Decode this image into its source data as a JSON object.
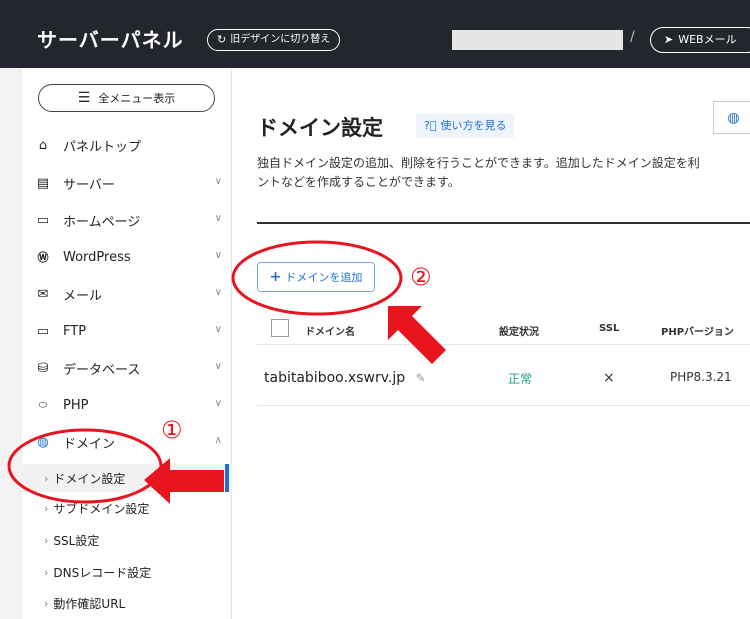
{
  "header": {
    "brand": "サーバーパネル",
    "old_design_label": "旧デザインに切り替え",
    "separator": "/",
    "webmail_label": "WEBメール"
  },
  "sidebar": {
    "menu_all_label": "全メニュー表示",
    "items": [
      {
        "label": "パネルトップ",
        "icon": "home-icon"
      },
      {
        "label": "サーバー",
        "icon": "server-icon"
      },
      {
        "label": "ホームページ",
        "icon": "window-icon"
      },
      {
        "label": "WordPress",
        "icon": "wordpress-icon"
      },
      {
        "label": "メール",
        "icon": "mail-icon"
      },
      {
        "label": "FTP",
        "icon": "monitor-icon"
      },
      {
        "label": "データベース",
        "icon": "database-icon"
      },
      {
        "label": "PHP",
        "icon": "php-icon"
      },
      {
        "label": "ドメイン",
        "icon": "globe-icon"
      }
    ],
    "sub_items": [
      {
        "label": "ドメイン設定"
      },
      {
        "label": "サブドメイン設定"
      },
      {
        "label": "SSL設定"
      },
      {
        "label": "DNSレコード設定"
      },
      {
        "label": "動作確認URL"
      }
    ]
  },
  "main": {
    "title": "ドメイン設定",
    "howto_label": "使い方を見る",
    "description_line1": "独自ドメイン設定の追加、削除を行うことができます。追加したドメイン設定を利",
    "description_line2": "ントなどを作成することができます。",
    "add_domain_label": "ドメインを追加",
    "table": {
      "headers": {
        "domain": "ドメイン名",
        "status": "設定状況",
        "ssl": "SSL",
        "php": "PHPバージョン"
      },
      "rows": [
        {
          "domain": "tabitabiboo.xswrv.jp",
          "status": "正常",
          "ssl": "×",
          "php": "PHP8.3.21"
        }
      ]
    }
  },
  "annotations": {
    "marker1": "①",
    "marker2": "②",
    "color": "#e8141e"
  }
}
